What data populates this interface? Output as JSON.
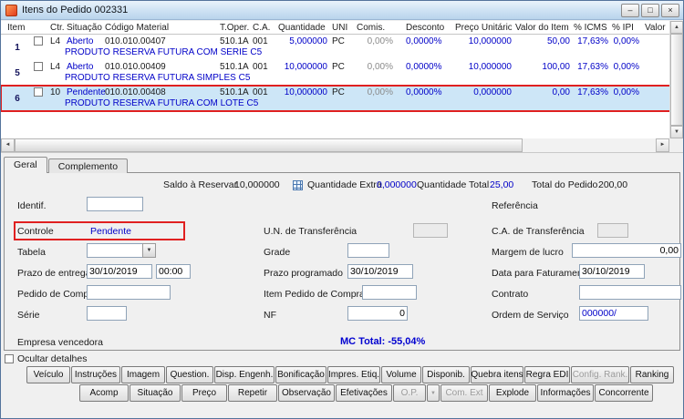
{
  "window": {
    "title": "Itens do Pedido 002331"
  },
  "icons": {
    "minimize": "–",
    "maximize": "□",
    "close": "×",
    "up": "▲",
    "down": "▼",
    "left": "◄",
    "right": "►",
    "dropdown": "▼"
  },
  "colors": {
    "accent_blue": "#0000c8",
    "selection_bg": "#cde6f7",
    "annotation_red": "#e02020"
  },
  "grid": {
    "columns": [
      "Item",
      "Ctr.",
      "Situação",
      "Código Material",
      "T.Oper.",
      "C.A.",
      "Quantidade",
      "UNI",
      "Comis.",
      "Desconto",
      "Preço Unitário",
      "Valor do Item",
      "% ICMS",
      "% IPI",
      "Valor IPI"
    ],
    "rows": [
      {
        "item": "1",
        "ctr": "L4",
        "situacao": "Aberto",
        "codigo": "010.010.00407",
        "toper": "510.1A",
        "ca": "001",
        "quantidade": "5,000000",
        "uni": "PC",
        "comis": "0,00%",
        "desconto": "0,0000%",
        "preco_unitario": "10,000000",
        "valor_item": "50,00",
        "icms": "17,63%",
        "ipi": "0,00%",
        "descricao": "PRODUTO RESERVA FUTURA COM SERIE C5",
        "selected": false
      },
      {
        "item": "5",
        "ctr": "L4",
        "situacao": "Aberto",
        "codigo": "010.010.00409",
        "toper": "510.1A",
        "ca": "001",
        "quantidade": "10,000000",
        "uni": "PC",
        "comis": "0,00%",
        "desconto": "0,0000%",
        "preco_unitario": "10,000000",
        "valor_item": "100,00",
        "icms": "17,63%",
        "ipi": "0,00%",
        "descricao": "PRODUTO RESERVA FUTURA SIMPLES C5",
        "selected": false
      },
      {
        "item": "6",
        "ctr": "10",
        "situacao": "Pendente",
        "codigo": "010.010.00408",
        "toper": "510.1A",
        "ca": "001",
        "quantidade": "10,000000",
        "uni": "PC",
        "comis": "0,00%",
        "desconto": "0,0000%",
        "preco_unitario": "0,000000",
        "valor_item": "0,00",
        "icms": "17,63%",
        "ipi": "0,00%",
        "descricao": "PRODUTO RESERVA FUTURA  COM LOTE C5",
        "selected": true
      }
    ]
  },
  "tabs": {
    "geral": "Geral",
    "complemento": "Complemento"
  },
  "summary": {
    "saldo_label": "Saldo à Reservar",
    "saldo_value": "10,000000",
    "extra_label": "Quantidade Extra",
    "extra_value": "0,000000",
    "total_label": "Quantidade Total",
    "total_value": "25,00",
    "pedido_label": "Total do Pedido",
    "pedido_value": "200,00"
  },
  "form": {
    "identif": {
      "label": "Identif."
    },
    "referencia": {
      "label": "Referência"
    },
    "controle": {
      "label": "Controle",
      "value": "Pendente"
    },
    "un_transferencia": {
      "label": "U.N. de Transferência"
    },
    "ca_transferencia": {
      "label": "C.A. de Transferência"
    },
    "tabela": {
      "label": "Tabela"
    },
    "grade": {
      "label": "Grade"
    },
    "margem": {
      "label": "Margem de lucro",
      "value": "0,00"
    },
    "prazo_entrega": {
      "label": "Prazo de entrega",
      "date": "30/10/2019",
      "time": "00:00"
    },
    "prazo_programado": {
      "label": "Prazo programado",
      "value": "30/10/2019"
    },
    "data_faturamento": {
      "label": "Data para Faturamento",
      "value": "30/10/2019"
    },
    "pedido_compra": {
      "label": "Pedido de Compra"
    },
    "item_pedido_compra": {
      "label": "Item Pedido de Compra"
    },
    "contrato": {
      "label": "Contrato"
    },
    "serie": {
      "label": "Série"
    },
    "nf": {
      "label": "NF",
      "value": "0"
    },
    "ordem_servico": {
      "label": "Ordem de Serviço",
      "value": "000000/"
    },
    "empresa_vencedora": {
      "label": "Empresa vencedora"
    },
    "mc_total": "MC Total: -55,04%"
  },
  "ocultar_detalhes": "Ocultar detalhes",
  "buttons": {
    "row1": [
      {
        "label": "Veículo",
        "enabled": true
      },
      {
        "label": "Instruções",
        "enabled": true
      },
      {
        "label": "Imagem",
        "enabled": true
      },
      {
        "label": "Question.",
        "enabled": true
      },
      {
        "label": "Disp. Engenh.",
        "enabled": true
      },
      {
        "label": "Bonificação",
        "enabled": true
      },
      {
        "label": "Impres. Etiq.",
        "enabled": true
      },
      {
        "label": "Volume",
        "enabled": true
      },
      {
        "label": "Disponib.",
        "enabled": true
      },
      {
        "label": "Quebra itens",
        "enabled": true
      },
      {
        "label": "Regra EDI",
        "enabled": true
      },
      {
        "label": "Config. Rank.",
        "enabled": false
      },
      {
        "label": "Ranking",
        "enabled": true
      }
    ],
    "row2": [
      {
        "label": "Acomp",
        "enabled": true
      },
      {
        "label": "Situação",
        "enabled": true
      },
      {
        "label": "Preço",
        "enabled": true
      },
      {
        "label": "Repetir",
        "enabled": true
      },
      {
        "label": "Observação",
        "enabled": true
      },
      {
        "label": "Efetivações",
        "enabled": true
      },
      {
        "label": "O.P.",
        "enabled": false
      },
      {
        "label": "Com. Ext",
        "enabled": false
      },
      {
        "label": "Explode",
        "enabled": true
      },
      {
        "label": "Informações",
        "enabled": true
      },
      {
        "label": "Concorrente",
        "enabled": true
      }
    ]
  }
}
